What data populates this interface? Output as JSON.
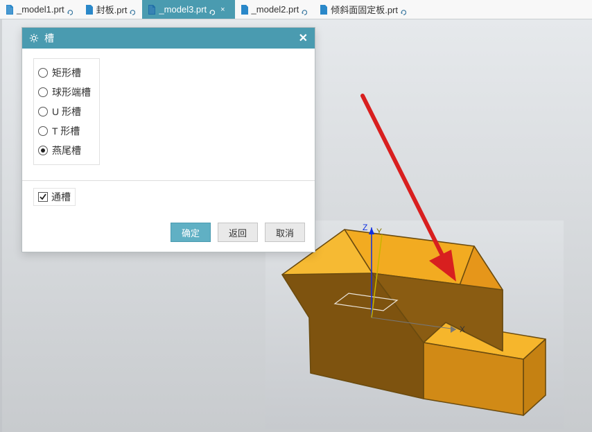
{
  "tabs": [
    {
      "label": "_model1.prt",
      "modified": true,
      "active": false
    },
    {
      "label": "封板.prt",
      "modified": true,
      "active": false
    },
    {
      "label": "_model3.prt",
      "modified": true,
      "active": true
    },
    {
      "label": "_model2.prt",
      "modified": true,
      "active": false
    },
    {
      "label": "倾斜面固定板.prt",
      "modified": true,
      "active": false
    }
  ],
  "dialog": {
    "title": "槽",
    "options": [
      {
        "label": "矩形槽",
        "selected": false
      },
      {
        "label": "球形端槽",
        "selected": false
      },
      {
        "label": "U 形槽",
        "selected": false
      },
      {
        "label": "T 形槽",
        "selected": false
      },
      {
        "label": "燕尾槽",
        "selected": true
      }
    ],
    "through_label": "通槽",
    "through_checked": true,
    "buttons": {
      "ok": "确定",
      "back": "返回",
      "cancel": "取消"
    }
  },
  "axis": {
    "x": "X",
    "y": "Y",
    "z": "Z"
  }
}
